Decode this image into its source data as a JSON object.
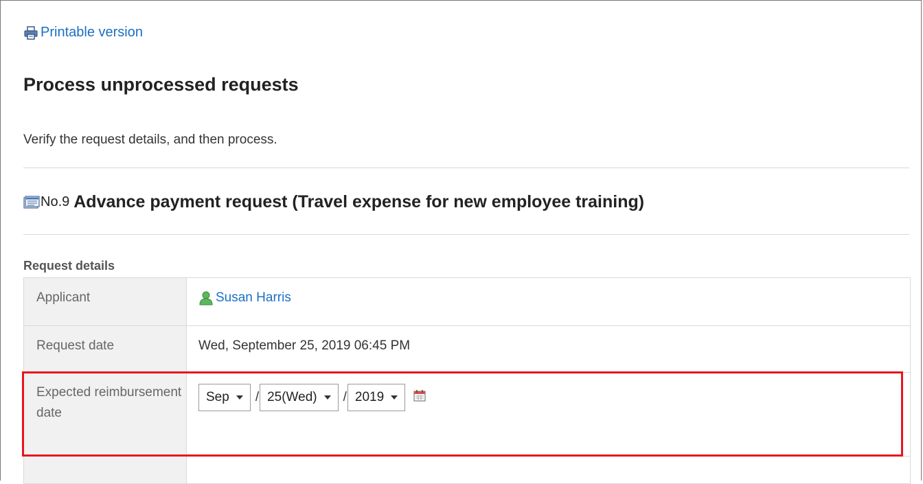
{
  "printable_link": "Printable version",
  "page_title": "Process unprocessed requests",
  "description": "Verify the request details, and then process.",
  "request": {
    "number": "No.9",
    "name": "Advance payment request (Travel expense for new employee training)"
  },
  "details_section": {
    "label": "Request details",
    "rows": {
      "applicant": {
        "label": "Applicant",
        "value": "Susan Harris"
      },
      "request_date": {
        "label": "Request date",
        "value": "Wed, September 25, 2019 06:45 PM"
      },
      "expected_date": {
        "label": "Expected reimbursement date",
        "month": "Sep",
        "day": "25(Wed)",
        "year": "2019",
        "separator": "/"
      }
    }
  },
  "colors": {
    "link": "#1a6fc4",
    "highlight": "#e8141c",
    "label_bg": "#f1f1f1"
  },
  "icons": [
    "printer-icon",
    "document-icon",
    "user-icon",
    "calendar-icon"
  ]
}
